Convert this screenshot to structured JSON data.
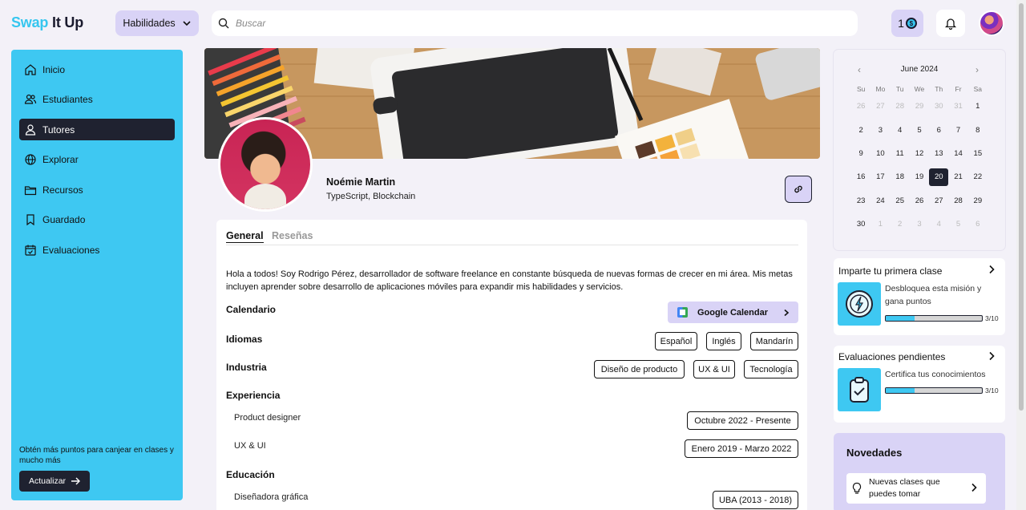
{
  "brand": {
    "part1": "Swap",
    "part2": "It Up"
  },
  "header": {
    "skills_label": "Habilidades",
    "search_placeholder": "Buscar",
    "points": "1"
  },
  "sidebar": {
    "items": [
      {
        "label": "Inicio",
        "icon": "home-icon"
      },
      {
        "label": "Estudiantes",
        "icon": "students-icon"
      },
      {
        "label": "Tutores",
        "icon": "user-icon"
      },
      {
        "label": "Explorar",
        "icon": "globe-icon"
      },
      {
        "label": "Recursos",
        "icon": "folder-icon"
      },
      {
        "label": "Guardado",
        "icon": "bookmark-icon"
      },
      {
        "label": "Evaluaciones",
        "icon": "calendar-check-icon"
      }
    ],
    "active": "Tutores",
    "note": "Obtén más puntos para canjear en clases y mucho más",
    "upgrade_label": "Actualizar"
  },
  "profile": {
    "name": "Noémie Martin",
    "skills": "TypeScript, Blockchain"
  },
  "tabs": {
    "general": "General",
    "reviews": "Reseñas"
  },
  "content": {
    "bio": "Hola a todos! Soy Rodrigo Pérez, desarrollador de software freelance en constante búsqueda de nuevas formas de crecer en mi área. Mis metas incluyen aprender sobre desarrollo de aplicaciones móviles para expandir mis habilidades y servicios.",
    "calendar_heading": "Calendario",
    "gcal_label": "Google Calendar",
    "languages_heading": "Idiomas",
    "languages": [
      "Español",
      "Inglés",
      "Mandarín"
    ],
    "industry_heading": "Industria",
    "industries": [
      "Diseño de producto",
      "UX & UI",
      "Tecnología"
    ],
    "experience_heading": "Experiencia",
    "experience": [
      {
        "role": "Product designer",
        "period": "Octubre 2022 - Presente"
      },
      {
        "role": "UX & UI",
        "period": "Enero 2019 - Marzo 2022"
      }
    ],
    "education_heading": "Educación",
    "education": [
      {
        "title": "Diseñadora gráfica",
        "period": "UBA (2013 - 2018)"
      }
    ]
  },
  "calendar": {
    "month": "June 2024",
    "weekdays": [
      "Su",
      "Mo",
      "Tu",
      "We",
      "Th",
      "Fr",
      "Sa"
    ],
    "weeks": [
      [
        "26",
        "27",
        "28",
        "29",
        "30",
        "31",
        "1"
      ],
      [
        "2",
        "3",
        "4",
        "5",
        "6",
        "7",
        "8"
      ],
      [
        "9",
        "10",
        "11",
        "12",
        "13",
        "14",
        "15"
      ],
      [
        "16",
        "17",
        "18",
        "19",
        "20",
        "21",
        "22"
      ],
      [
        "23",
        "24",
        "25",
        "26",
        "27",
        "28",
        "29"
      ],
      [
        "30",
        "1",
        "2",
        "3",
        "4",
        "5",
        "6"
      ]
    ],
    "selected": "20"
  },
  "missions": [
    {
      "title": "Imparte tu primera clase",
      "desc": "Desbloquea esta misión y gana puntos",
      "count": "3/10",
      "progress": 0.3
    },
    {
      "title": "Evaluaciones pendientes",
      "desc": "Certifica tus conocimientos",
      "count": "3/10",
      "progress": 0.3
    }
  ],
  "news": {
    "title": "Novedades",
    "item": "Nuevas clases que puedes tomar"
  },
  "colors": {
    "accent": "#3ec8f2",
    "lavender": "#d9d3f6",
    "dark": "#1f2230"
  }
}
